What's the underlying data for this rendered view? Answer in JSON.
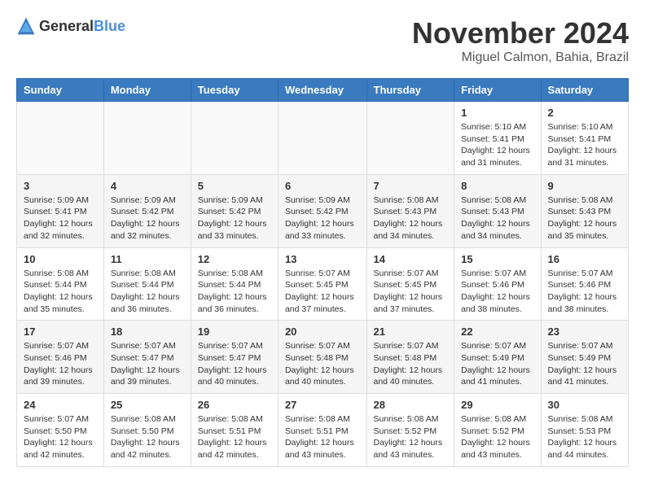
{
  "logo": {
    "general": "General",
    "blue": "Blue"
  },
  "title": "November 2024",
  "location": "Miguel Calmon, Bahia, Brazil",
  "days_of_week": [
    "Sunday",
    "Monday",
    "Tuesday",
    "Wednesday",
    "Thursday",
    "Friday",
    "Saturday"
  ],
  "weeks": [
    [
      {
        "day": "",
        "info": ""
      },
      {
        "day": "",
        "info": ""
      },
      {
        "day": "",
        "info": ""
      },
      {
        "day": "",
        "info": ""
      },
      {
        "day": "",
        "info": ""
      },
      {
        "day": "1",
        "info": "Sunrise: 5:10 AM\nSunset: 5:41 PM\nDaylight: 12 hours\nand 31 minutes."
      },
      {
        "day": "2",
        "info": "Sunrise: 5:10 AM\nSunset: 5:41 PM\nDaylight: 12 hours\nand 31 minutes."
      }
    ],
    [
      {
        "day": "3",
        "info": "Sunrise: 5:09 AM\nSunset: 5:41 PM\nDaylight: 12 hours\nand 32 minutes."
      },
      {
        "day": "4",
        "info": "Sunrise: 5:09 AM\nSunset: 5:42 PM\nDaylight: 12 hours\nand 32 minutes."
      },
      {
        "day": "5",
        "info": "Sunrise: 5:09 AM\nSunset: 5:42 PM\nDaylight: 12 hours\nand 33 minutes."
      },
      {
        "day": "6",
        "info": "Sunrise: 5:09 AM\nSunset: 5:42 PM\nDaylight: 12 hours\nand 33 minutes."
      },
      {
        "day": "7",
        "info": "Sunrise: 5:08 AM\nSunset: 5:43 PM\nDaylight: 12 hours\nand 34 minutes."
      },
      {
        "day": "8",
        "info": "Sunrise: 5:08 AM\nSunset: 5:43 PM\nDaylight: 12 hours\nand 34 minutes."
      },
      {
        "day": "9",
        "info": "Sunrise: 5:08 AM\nSunset: 5:43 PM\nDaylight: 12 hours\nand 35 minutes."
      }
    ],
    [
      {
        "day": "10",
        "info": "Sunrise: 5:08 AM\nSunset: 5:44 PM\nDaylight: 12 hours\nand 35 minutes."
      },
      {
        "day": "11",
        "info": "Sunrise: 5:08 AM\nSunset: 5:44 PM\nDaylight: 12 hours\nand 36 minutes."
      },
      {
        "day": "12",
        "info": "Sunrise: 5:08 AM\nSunset: 5:44 PM\nDaylight: 12 hours\nand 36 minutes."
      },
      {
        "day": "13",
        "info": "Sunrise: 5:07 AM\nSunset: 5:45 PM\nDaylight: 12 hours\nand 37 minutes."
      },
      {
        "day": "14",
        "info": "Sunrise: 5:07 AM\nSunset: 5:45 PM\nDaylight: 12 hours\nand 37 minutes."
      },
      {
        "day": "15",
        "info": "Sunrise: 5:07 AM\nSunset: 5:46 PM\nDaylight: 12 hours\nand 38 minutes."
      },
      {
        "day": "16",
        "info": "Sunrise: 5:07 AM\nSunset: 5:46 PM\nDaylight: 12 hours\nand 38 minutes."
      }
    ],
    [
      {
        "day": "17",
        "info": "Sunrise: 5:07 AM\nSunset: 5:46 PM\nDaylight: 12 hours\nand 39 minutes."
      },
      {
        "day": "18",
        "info": "Sunrise: 5:07 AM\nSunset: 5:47 PM\nDaylight: 12 hours\nand 39 minutes."
      },
      {
        "day": "19",
        "info": "Sunrise: 5:07 AM\nSunset: 5:47 PM\nDaylight: 12 hours\nand 40 minutes."
      },
      {
        "day": "20",
        "info": "Sunrise: 5:07 AM\nSunset: 5:48 PM\nDaylight: 12 hours\nand 40 minutes."
      },
      {
        "day": "21",
        "info": "Sunrise: 5:07 AM\nSunset: 5:48 PM\nDaylight: 12 hours\nand 40 minutes."
      },
      {
        "day": "22",
        "info": "Sunrise: 5:07 AM\nSunset: 5:49 PM\nDaylight: 12 hours\nand 41 minutes."
      },
      {
        "day": "23",
        "info": "Sunrise: 5:07 AM\nSunset: 5:49 PM\nDaylight: 12 hours\nand 41 minutes."
      }
    ],
    [
      {
        "day": "24",
        "info": "Sunrise: 5:07 AM\nSunset: 5:50 PM\nDaylight: 12 hours\nand 42 minutes."
      },
      {
        "day": "25",
        "info": "Sunrise: 5:08 AM\nSunset: 5:50 PM\nDaylight: 12 hours\nand 42 minutes."
      },
      {
        "day": "26",
        "info": "Sunrise: 5:08 AM\nSunset: 5:51 PM\nDaylight: 12 hours\nand 42 minutes."
      },
      {
        "day": "27",
        "info": "Sunrise: 5:08 AM\nSunset: 5:51 PM\nDaylight: 12 hours\nand 43 minutes."
      },
      {
        "day": "28",
        "info": "Sunrise: 5:08 AM\nSunset: 5:52 PM\nDaylight: 12 hours\nand 43 minutes."
      },
      {
        "day": "29",
        "info": "Sunrise: 5:08 AM\nSunset: 5:52 PM\nDaylight: 12 hours\nand 43 minutes."
      },
      {
        "day": "30",
        "info": "Sunrise: 5:08 AM\nSunset: 5:53 PM\nDaylight: 12 hours\nand 44 minutes."
      }
    ]
  ]
}
